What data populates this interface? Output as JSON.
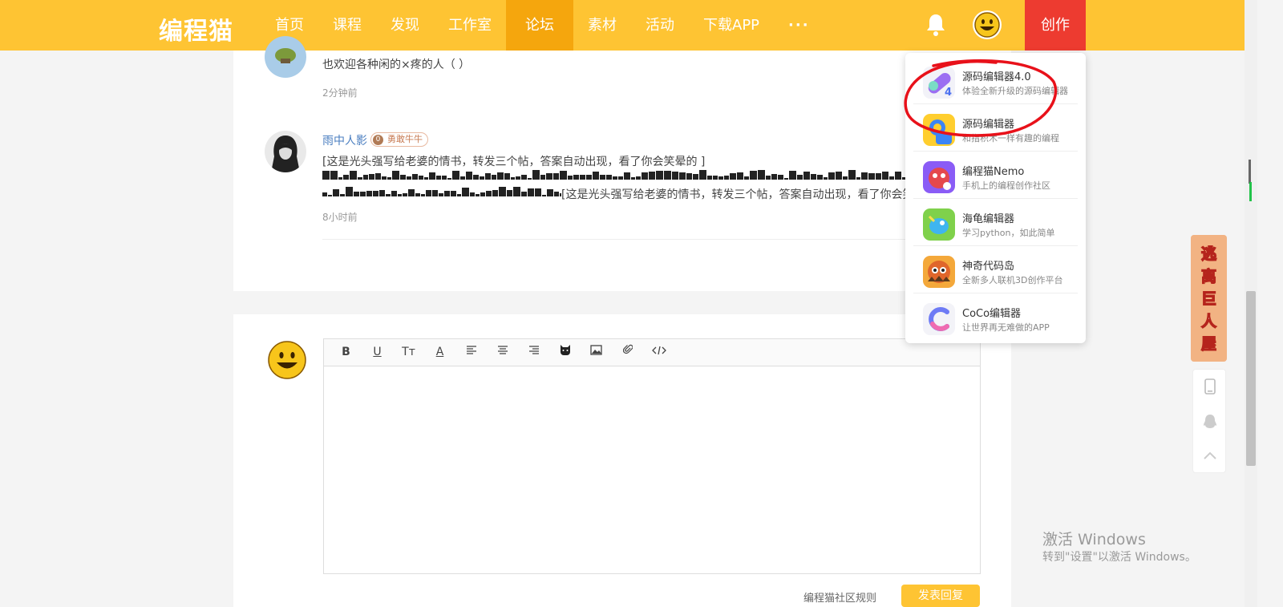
{
  "brand": {
    "logo": "编程猫",
    "accent": "#fec433",
    "create_color": "#ed3b30"
  },
  "nav": {
    "items": [
      "首页",
      "课程",
      "发现",
      "工作室",
      "论坛",
      "素材",
      "活动",
      "下载APP"
    ],
    "active": "论坛",
    "more": "···",
    "create_label": "创作"
  },
  "comments": [
    {
      "text": "也欢迎各种闲的×疼的人（ ）",
      "time": "2分钟前"
    },
    {
      "username": "雨中人影",
      "badge_level": "0",
      "badge_label": "勇敢牛牛",
      "text": "[这是光头强写给老婆的情书，转发三个帖，答案自动出现，看了你会笑晕的 ]",
      "line2_text": "[这是光头强写给老婆的情书，转发三个帖，答案自动出现，看了你会笑",
      "time": "8小时前"
    }
  ],
  "editor": {
    "toolbar": [
      "B",
      "U",
      "Tт",
      "A",
      "align-left-icon",
      "align-center-icon",
      "align-right-icon",
      "cat-emoji-icon",
      "image-icon",
      "attachment-icon",
      "code-icon"
    ],
    "hint": "编程猫社区规则",
    "submit": "发表回复"
  },
  "dropdown": {
    "items": [
      {
        "title": "源码编辑器4.0",
        "subtitle": "体验全新升级的源码编辑器"
      },
      {
        "title": "源码编辑器",
        "subtitle": "和指积木一样有趣的编程"
      },
      {
        "title": "编程猫Nemo",
        "subtitle": "手机上的编程创作社区"
      },
      {
        "title": "海龟编辑器",
        "subtitle": "学习python，如此简单"
      },
      {
        "title": "神奇代码岛",
        "subtitle": "全新多人联机3D创作平台"
      },
      {
        "title": "CoCo编辑器",
        "subtitle": "让世界再无难做的APP"
      }
    ]
  },
  "side": {
    "ad_text": "逃离巨人屋"
  },
  "watermark": {
    "line1": "激活 Windows",
    "line2": "转到\"设置\"以激活 Windows。"
  }
}
